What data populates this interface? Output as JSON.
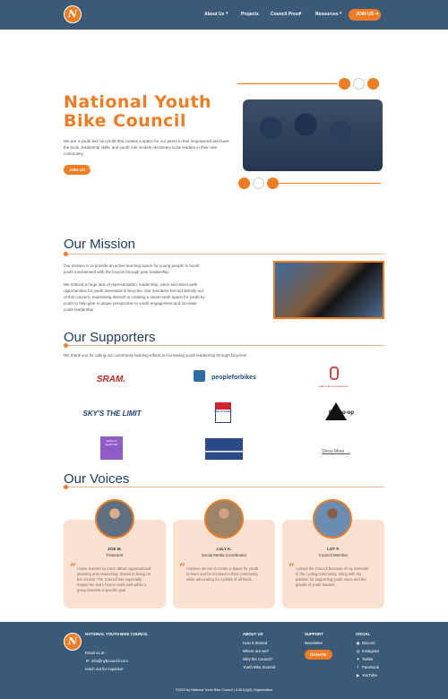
{
  "header": {
    "logo": "N",
    "links": [
      "About Us",
      "Projects",
      "Council Press",
      "Resources"
    ],
    "join": "JOIN US"
  },
  "hero": {
    "title": "National Youth Bike Council",
    "text": "We are a youth-led non-profit that creates a space for our peers to feel empowered and have the tools, leadership skills, and youth role models necessary to be leaders in their own community.",
    "button": "JOIN US"
  },
  "mission": {
    "heading": "Our Mission",
    "p1": "Our mission is to provide an active learning space for young people to boost youth involvement with the bicycle through peer leadership.",
    "p2": "We noticed a huge lack of representation, leadership, voice and direct-path opportunities for youth interested in bicycles. Our members formed directly out of this concern, expressing interest in creating a nation-wide space for youth by youth to help give a unique perspective to youth engagement and increase youth leadership."
  },
  "supporters": {
    "heading": "Our Supporters",
    "text": "We thank you for aiding our community building efforts in increasing youth leadership through bicycles!",
    "brands": [
      "SRAM.",
      "peopleforbikes",
      "QUALITY BICYCLE PRODUCTS",
      "SKY'S THE LIMIT",
      "USA CYCLING",
      "REI co-op",
      "WASH & SUPPORT",
      "",
      "Show More →"
    ]
  },
  "voices": {
    "heading": "Our Voices",
    "people": [
      {
        "name": "ZOE M.",
        "role": "Treasurer",
        "quote": "I have learned so much about organizational planning and networking, thanks to being on the council. The Council has especially helped me learn how to work well within a group towards a specific goal."
      },
      {
        "name": "LULY K.",
        "role": "Social Media Coordinator",
        "quote": "I believe we are to create a space for youth to learn and be involved in their community, while advocating for cyclists of all kinds."
      },
      {
        "name": "LOT F.",
        "role": "Council Member",
        "quote": "I joined the Council because of my interests in the cycling community, along with my passion for supporting youth voice and the growth of youth leaders."
      }
    ]
  },
  "footer": {
    "name": "NATIONAL YOUTH BIKE COUNCIL",
    "email_label": "Email us at -",
    "email": "info@nybcouncil.com",
    "reach": "reach out for inquiries!",
    "about_title": "ABOUT US",
    "about": [
      "How It Started",
      "Where are we?",
      "Why the Council?",
      "Youth Bike Summit"
    ],
    "support_title": "SUPPORT",
    "support": [
      "Newsletter"
    ],
    "donate": "DONATE",
    "social_title": "SOCIAL",
    "social": [
      "Discord",
      "Instagram",
      "Twitter",
      "Facebook",
      "YouTube"
    ],
    "copyright": "©2023 by National Youth Bike Council | A 501(c)(3) Organization"
  }
}
